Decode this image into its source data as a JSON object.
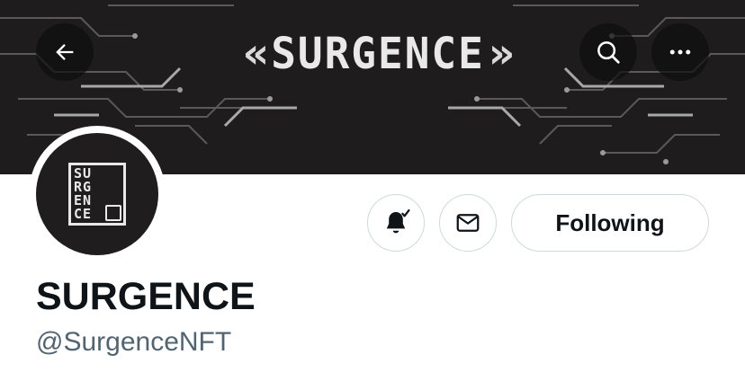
{
  "banner": {
    "wordmark": "SURGENCE",
    "chevron_left": "«",
    "chevron_right": "»",
    "background_color": "#1e1c1d"
  },
  "nav": {
    "back_icon": "arrow-left-icon",
    "search_icon": "search-icon",
    "more_icon": "more-horizontal-icon"
  },
  "avatar": {
    "logo_lines": [
      "SU",
      "RG",
      "EN",
      "CE"
    ]
  },
  "actions": {
    "notify_icon": "bell-checked-icon",
    "message_icon": "envelope-icon",
    "following_label": "Following"
  },
  "profile": {
    "display_name": "SURGENCE",
    "handle": "@SurgenceNFT"
  },
  "colors": {
    "text_primary": "#0f1419",
    "text_secondary": "#536471",
    "border": "#cfd9de"
  }
}
